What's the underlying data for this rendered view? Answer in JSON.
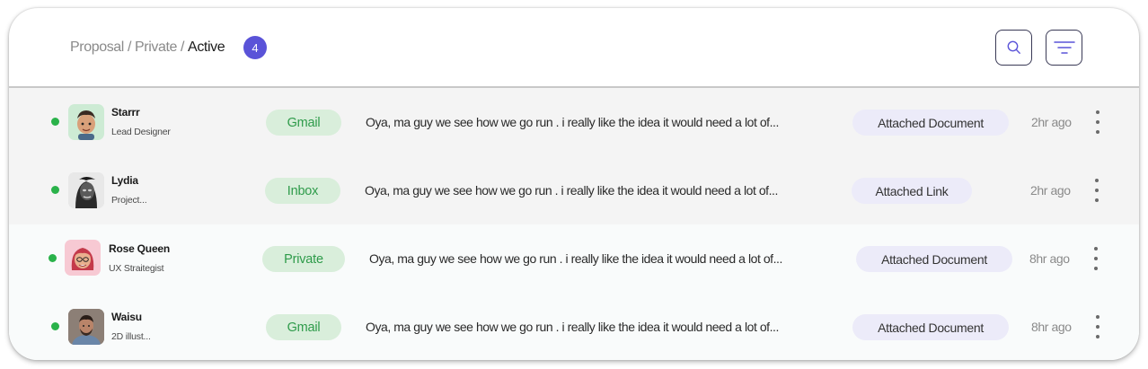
{
  "header": {
    "breadcrumb": [
      {
        "label": "Proposal"
      },
      {
        "label": "Private"
      },
      {
        "label": "Active"
      }
    ],
    "separator": "/",
    "count": "4"
  },
  "rows": [
    {
      "name": "Starrr",
      "role": "Lead Designer",
      "channel": "Gmail",
      "message": "Oya, ma guy we see how we go run . i really like the idea it would need a lot of...",
      "attachment": "Attached Document",
      "time": "2hr ago",
      "avatar_icon": "memoji-man-avatar",
      "avatar_bg": "#cdebd4"
    },
    {
      "name": "Lydia",
      "role": "Project...",
      "channel": "Inbox",
      "message": "Oya, ma guy we see how we go run . i really like the idea it would need a lot of...",
      "attachment": "Attached Link",
      "time": "2hr ago",
      "avatar_icon": "woman-photo-avatar",
      "avatar_bg": "#e2e2e2"
    },
    {
      "name": "Rose Queen",
      "role": "UX Straitegist",
      "channel": "Private",
      "message": "Oya, ma guy we see how we go run . i really like the idea it would need a lot of...",
      "attachment": "Attached Document",
      "time": "8hr ago",
      "avatar_icon": "memoji-woman-avatar",
      "avatar_bg": "#f7c9d3"
    },
    {
      "name": "Waisu",
      "role": "2D illust...",
      "channel": "Gmail",
      "message": "Oya, ma guy we see how we go run . i really like the idea it would need a lot of...",
      "attachment": "Attached Document",
      "time": "8hr ago",
      "avatar_icon": "man-photo-avatar",
      "avatar_bg": "#8c7f76"
    }
  ],
  "colors": {
    "accent": "#5a53d8",
    "online": "#2ab24a",
    "channel_bg": "#d9eedb",
    "channel_text": "#2e9b4a",
    "attachment_bg": "#ecebf9"
  }
}
